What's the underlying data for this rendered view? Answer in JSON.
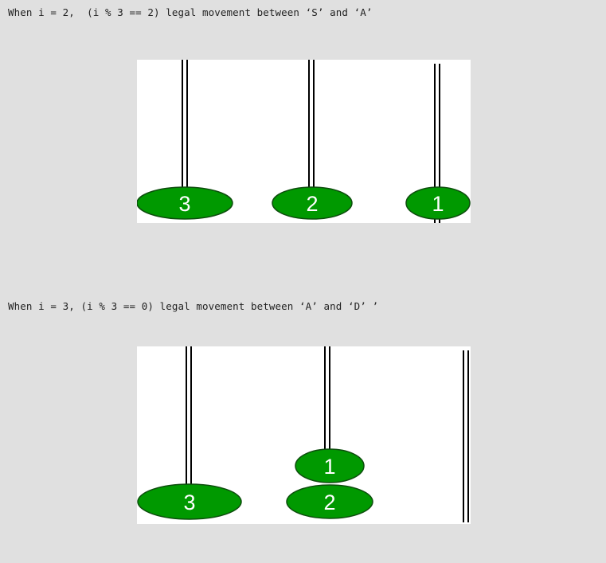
{
  "captions": {
    "step2": "When i = 2,  (i % 3 == 2) legal movement between ‘S’ and ‘A’",
    "step3": "When i = 3, (i % 3 == 0) legal movement between ‘A’ and ‘D’ ’"
  },
  "diagrams": [
    {
      "step": 2,
      "pegs": [
        {
          "disks": [
            "3"
          ]
        },
        {
          "disks": [
            "2"
          ]
        },
        {
          "disks": [
            "1"
          ]
        }
      ]
    },
    {
      "step": 3,
      "pegs": [
        {
          "disks": [
            "3"
          ]
        },
        {
          "disks": [
            "2",
            "1"
          ]
        },
        {
          "disks": []
        }
      ]
    }
  ],
  "colors": {
    "disk_fill": "#009900",
    "disk_outline": "#0d4d0d",
    "disk_label": "#ffffff",
    "rod": "#000000",
    "panel_background": "#ffffff",
    "page_background": "#e0e0e0"
  }
}
